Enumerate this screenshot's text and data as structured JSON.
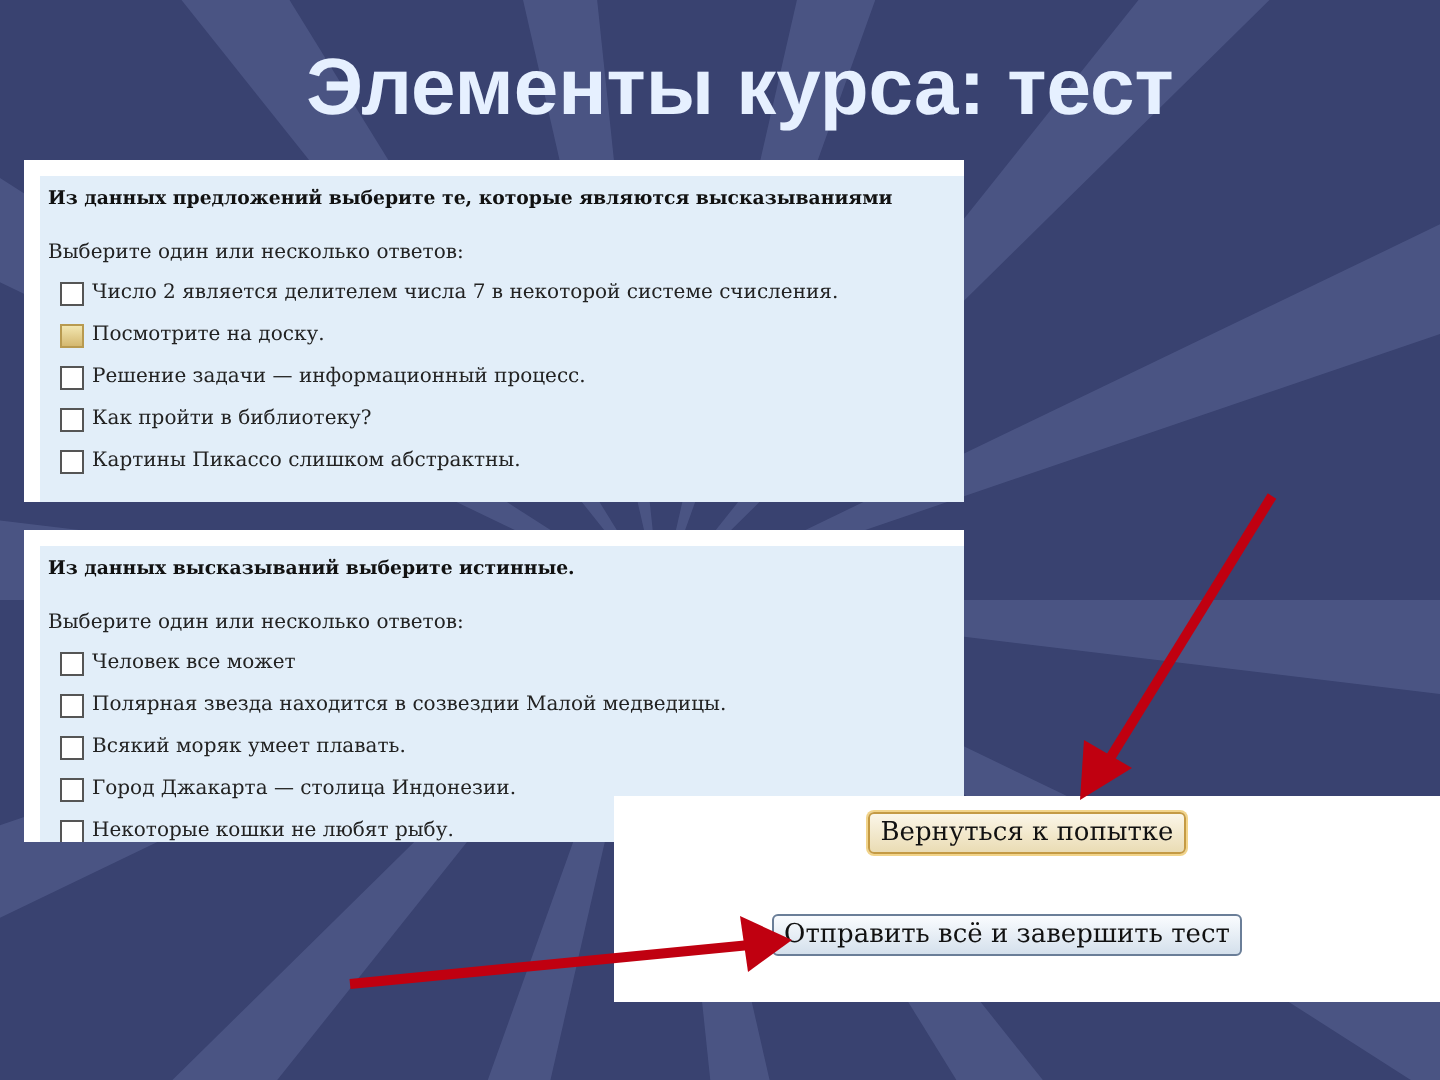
{
  "slide_title": "Элементы курса: тест",
  "questions": [
    {
      "prompt": "Из данных предложений выберите те, которые являются высказываниями",
      "instruction": "Выберите один или несколько ответов:",
      "options": [
        {
          "label": "Число 2 является делителем числа 7 в некоторой системе счисления.",
          "checked": false,
          "hovered": false
        },
        {
          "label": "Посмотрите на доску.",
          "checked": false,
          "hovered": true
        },
        {
          "label": "Решение задачи — информационный процесс.",
          "checked": false,
          "hovered": false
        },
        {
          "label": "Как пройти в библиотеку?",
          "checked": false,
          "hovered": false
        },
        {
          "label": "Картины Пикассо слишком абстрактны.",
          "checked": false,
          "hovered": false
        }
      ]
    },
    {
      "prompt": "Из данных высказываний выберите истинные.",
      "instruction": "Выберите один или несколько ответов:",
      "options": [
        {
          "label": "Человек все может",
          "checked": false,
          "hovered": false
        },
        {
          "label": "Полярная звезда находится в созвездии Малой медведицы.",
          "checked": false,
          "hovered": false
        },
        {
          "label": "Всякий моряк умеет плавать.",
          "checked": false,
          "hovered": false
        },
        {
          "label": "Город Джакарта — столица Индонезии.",
          "checked": false,
          "hovered": false
        },
        {
          "label": "Некоторые кошки не любят рыбу.",
          "checked": false,
          "hovered": false
        }
      ]
    }
  ],
  "buttons": [
    {
      "label": "Вернуться к попытке",
      "kind": "highlighted"
    },
    {
      "label": "Отправить всё и завершить тест",
      "kind": "default"
    }
  ]
}
